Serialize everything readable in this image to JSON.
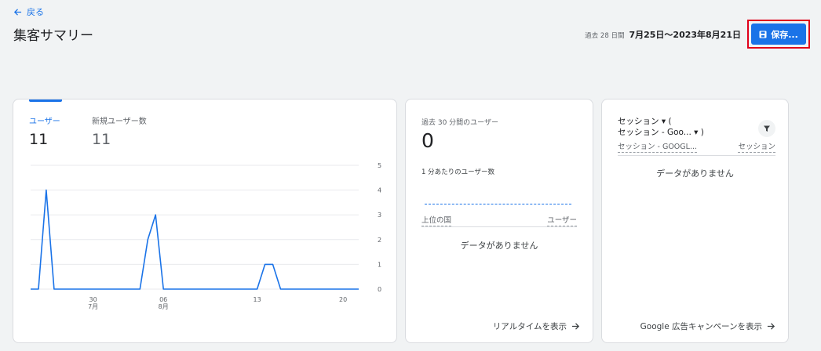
{
  "header": {
    "back_label": "戻る",
    "title": "集客サマリー",
    "date_preset": "過去 28 日間",
    "date_range": "7月25日～2023年8月21日",
    "save_label": "保存..."
  },
  "overview": {
    "metrics": [
      {
        "label": "ユーザー",
        "value": "11",
        "selected": true
      },
      {
        "label": "新規ユーザー数",
        "value": "11",
        "selected": false
      }
    ]
  },
  "realtime": {
    "title": "過去 30 分間のユーザー",
    "value": "0",
    "per_minute_label": "1 分あたりのユーザー数",
    "col_country": "上位の国",
    "col_users": "ユーザー",
    "no_data": "データがありません",
    "link_label": "リアルタイムを表示"
  },
  "sessions_card": {
    "dim_line1": "セッション ▾ (",
    "dim_line2": "セッション - Goo... ▾ )",
    "col_left": "セッション - GOOGL...",
    "col_right": "セッション",
    "no_data": "データがありません",
    "link_label": "Google 広告キャンペーンを表示"
  },
  "chart_data": {
    "type": "line",
    "series": [
      {
        "name": "ユーザー",
        "values": [
          0,
          0,
          4,
          0,
          0,
          0,
          0,
          0,
          0,
          0,
          0,
          0,
          0,
          0,
          0,
          2,
          3,
          0,
          0,
          0,
          0,
          0,
          0,
          0,
          0,
          0,
          0,
          0,
          0,
          0,
          1,
          1,
          0,
          0,
          0,
          0,
          0,
          0,
          0,
          0,
          0,
          0,
          0
        ]
      }
    ],
    "ylim": [
      0,
      5
    ],
    "y_ticks": [
      "0",
      "1",
      "2",
      "3",
      "4",
      "5"
    ],
    "x_ticks": [
      {
        "index": 8,
        "day": "30",
        "month": "7月"
      },
      {
        "index": 17,
        "day": "06",
        "month": "8月"
      },
      {
        "index": 29,
        "day": "13",
        "month": ""
      },
      {
        "index": 40,
        "day": "20",
        "month": ""
      }
    ],
    "line_color": "#1a73e8",
    "grid": true
  }
}
